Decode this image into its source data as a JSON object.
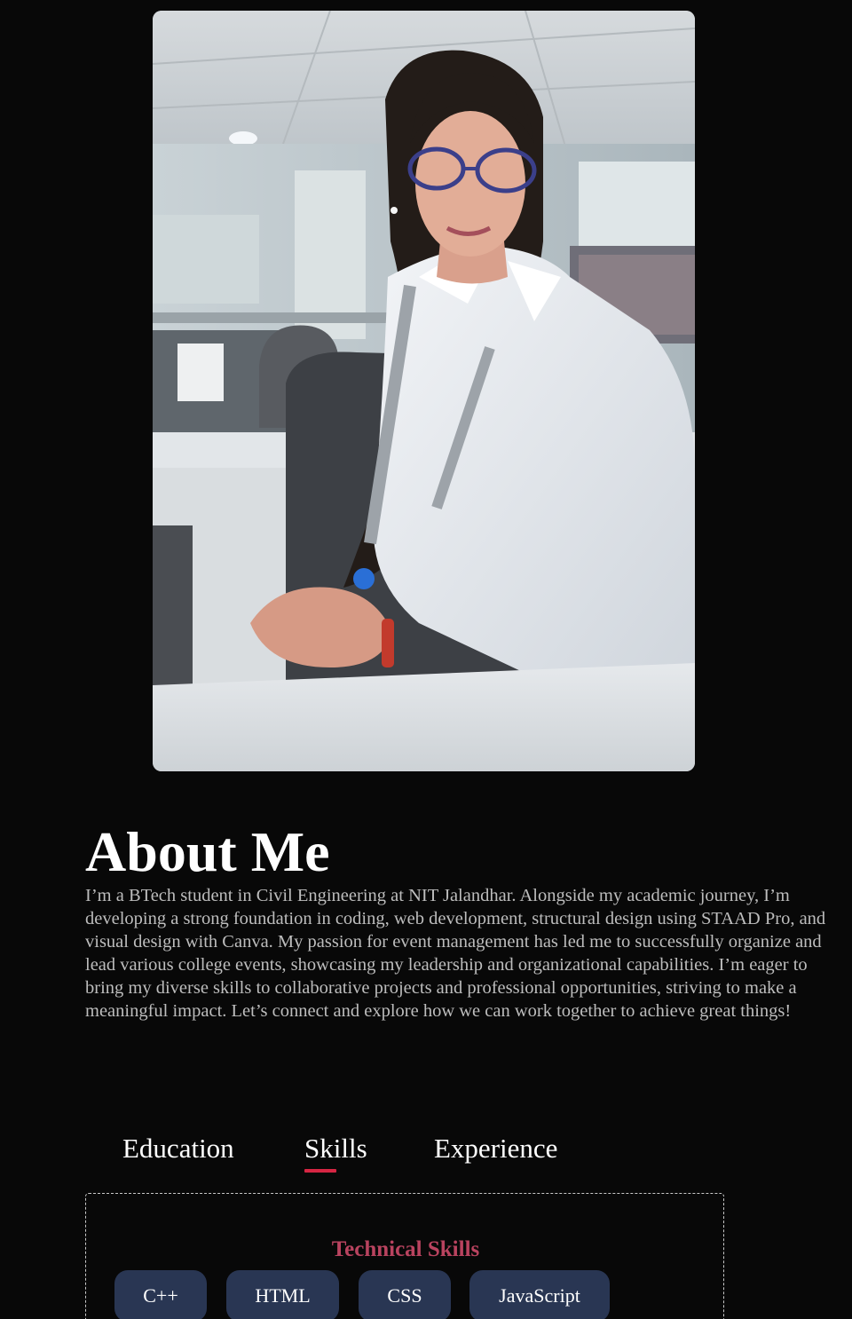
{
  "profile": {
    "photo_icon": "profile-photo"
  },
  "about": {
    "title": "About Me",
    "text": "I’m a BTech student in Civil Engineering at NIT Jalandhar. Alongside my academic journey, I’m developing a strong foundation in coding, web development, structural design using STAAD Pro, and visual design with Canva. My passion for event management has led me to successfully organize and lead various college events, showcasing my leadership and organizational capabilities. I’m eager to bring my diverse skills to collaborative projects and professional opportunities, striving to make a meaningful impact. Let’s connect and explore how we can work together to achieve great things!"
  },
  "tabs": [
    {
      "label": "Education",
      "active": false
    },
    {
      "label": "Skills",
      "active": true
    },
    {
      "label": "Experience",
      "active": false
    }
  ],
  "skills_panel": {
    "heading": "Technical Skills",
    "chips": [
      "C++",
      "HTML",
      "CSS",
      "JavaScript"
    ]
  },
  "colors": {
    "background": "#080808",
    "accent": "#d62543",
    "heading_accent": "#b9435f",
    "chip_bg": "#293653",
    "body_text": "#bdbdbd"
  }
}
